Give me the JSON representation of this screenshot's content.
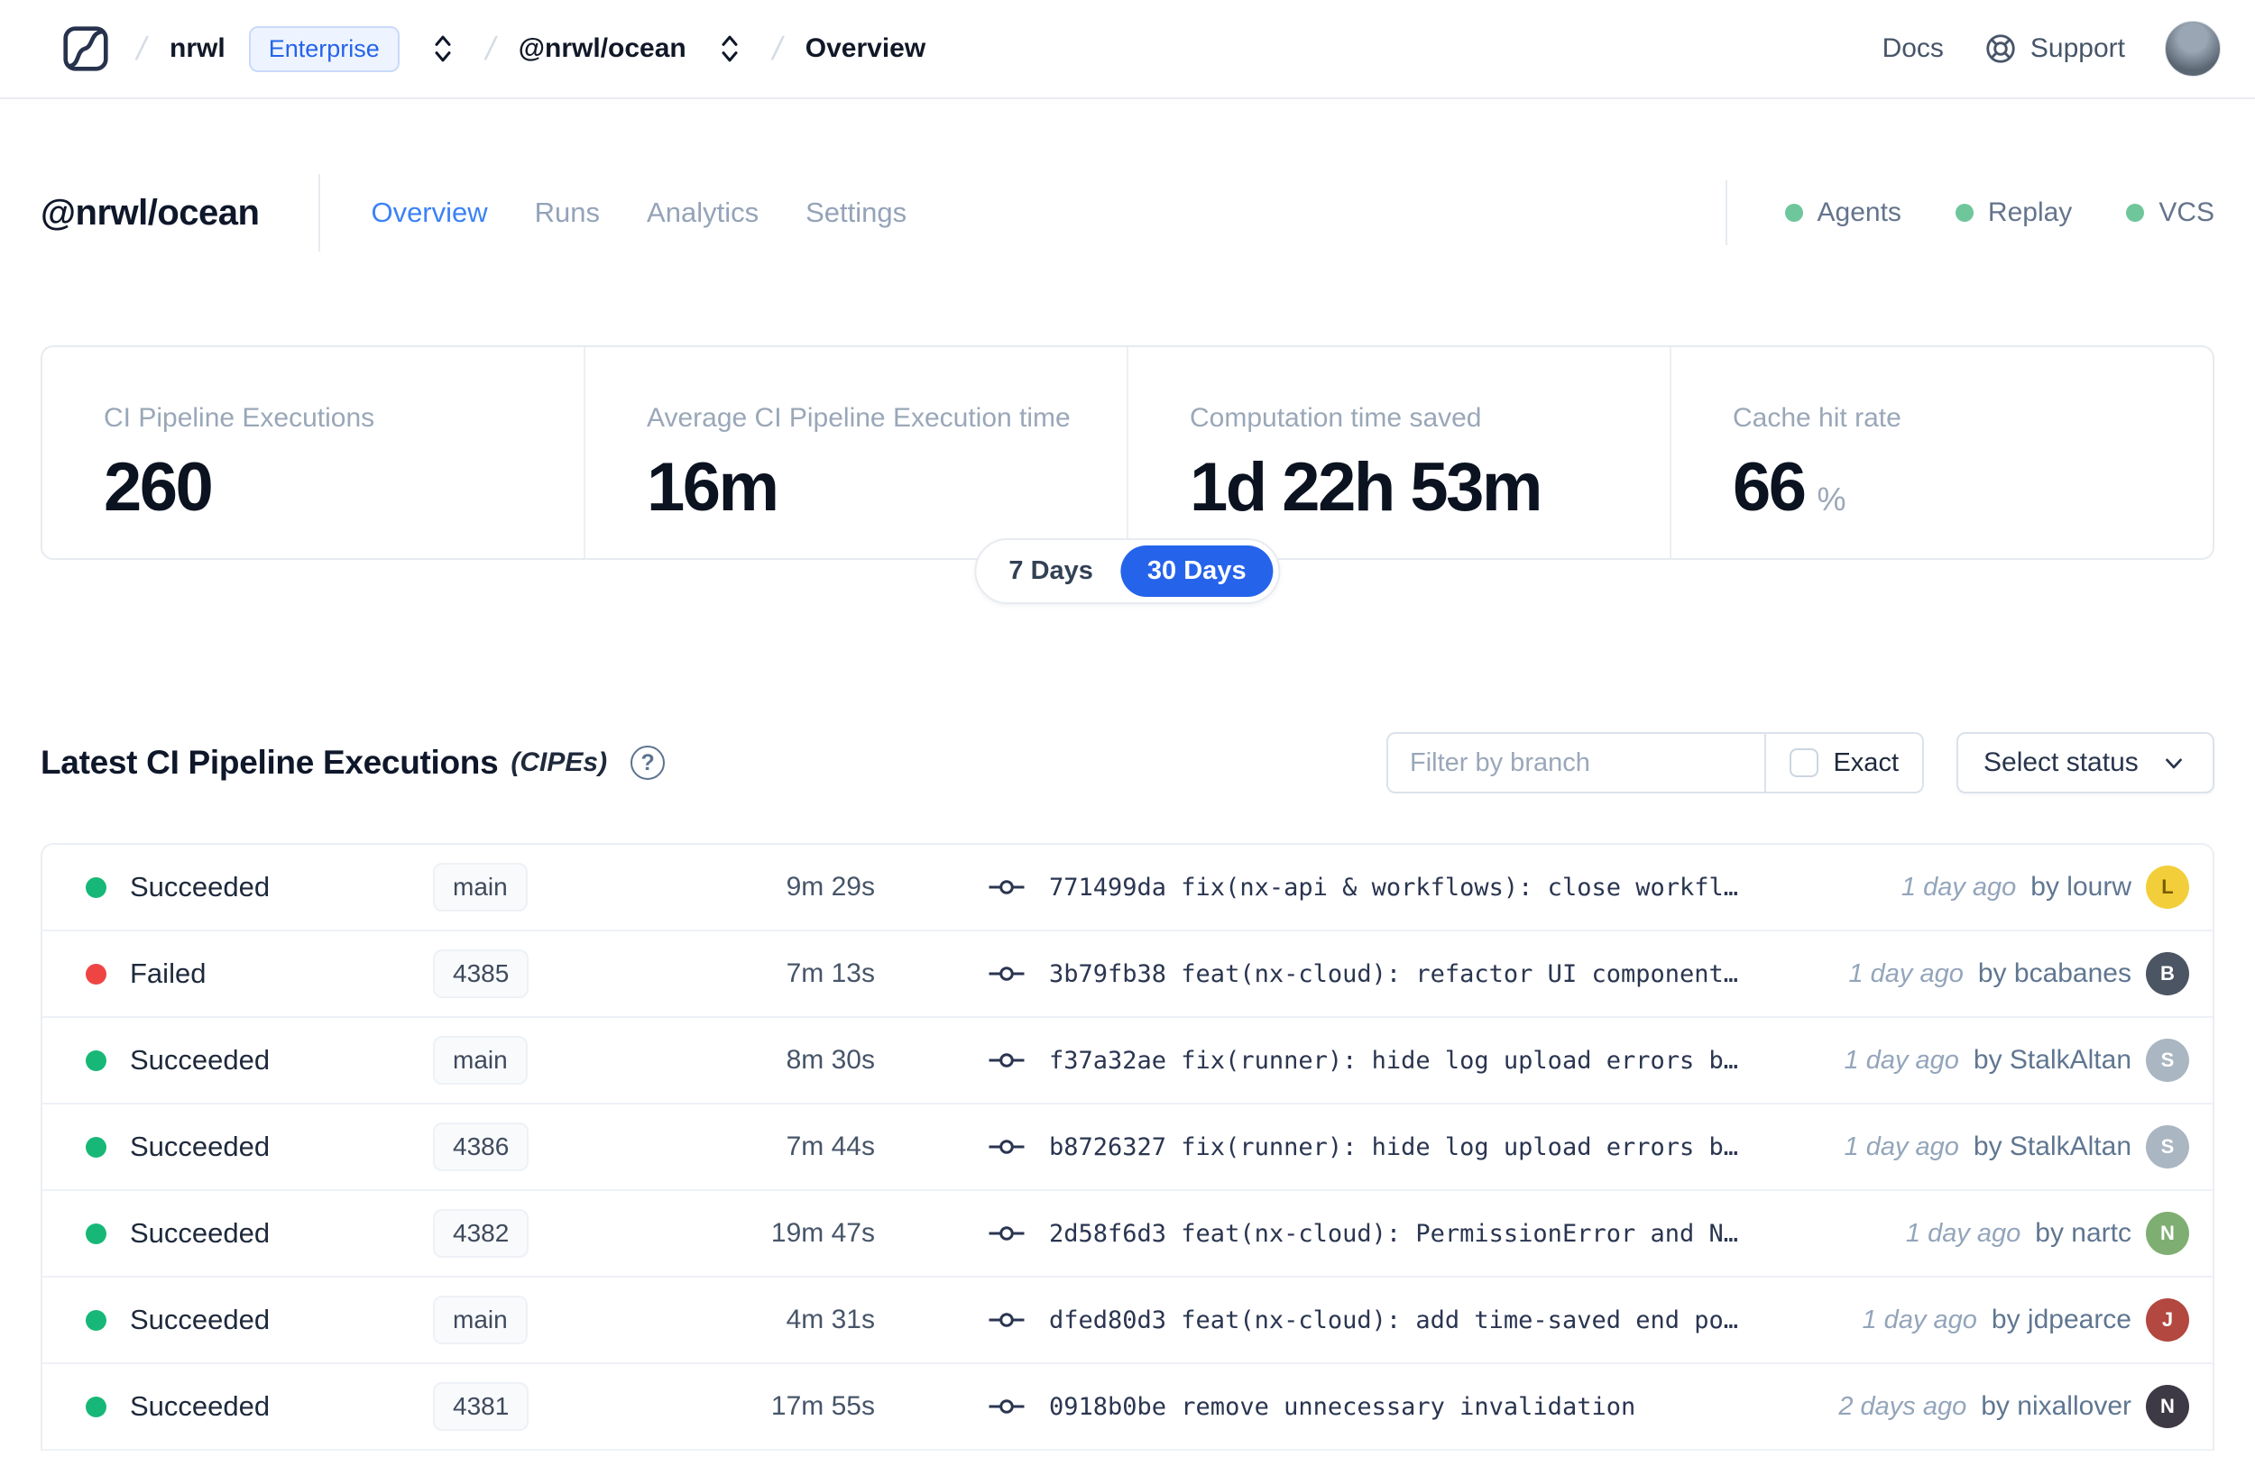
{
  "topbar": {
    "separator": "/",
    "org": "nrwl",
    "org_badge": "Enterprise",
    "workspace": "@nrwl/ocean",
    "page": "Overview",
    "docs_label": "Docs",
    "support_label": "Support"
  },
  "header": {
    "title": "@nrwl/ocean",
    "tabs": [
      {
        "label": "Overview"
      },
      {
        "label": "Runs"
      },
      {
        "label": "Analytics"
      },
      {
        "label": "Settings"
      }
    ],
    "features": [
      {
        "label": "Agents"
      },
      {
        "label": "Replay"
      },
      {
        "label": "VCS"
      }
    ],
    "feature_dot_color": "#6fc69b"
  },
  "stats": {
    "cards": [
      {
        "label": "CI Pipeline Executions",
        "value": "260"
      },
      {
        "label": "Average CI Pipeline Execution time",
        "value": "16m"
      },
      {
        "label": "Computation time saved",
        "value": "1d 22h 53m"
      },
      {
        "label": "Cache hit rate",
        "value": "66",
        "unit": "%"
      }
    ],
    "range_toggle": {
      "options": [
        "7 Days",
        "30 Days"
      ],
      "selected": "30 Days",
      "selected_color": "#2563eb"
    }
  },
  "section": {
    "title": "Latest CI Pipeline Executions",
    "subtitle": "(CIPEs)",
    "help_glyph": "?",
    "filter_placeholder": "Filter by branch",
    "exact_label": "Exact",
    "status_select_label": "Select status"
  },
  "table": {
    "rows": [
      {
        "status": "Succeeded",
        "status_color": "#17b877",
        "branch": "main",
        "duration": "9m 29s",
        "commit": "771499da fix(nx-api & workflows): close workfl…",
        "time": "1 day ago",
        "author": "by lourw",
        "avatar_initial": "L",
        "avatar_color": "#f2cf3a",
        "avatar_text_color": "#7a5d00"
      },
      {
        "status": "Failed",
        "status_color": "#ef4444",
        "branch": "4385",
        "duration": "7m 13s",
        "commit": "3b79fb38 feat(nx-cloud): refactor UI component…",
        "time": "1 day ago",
        "author": "by bcabanes",
        "avatar_initial": "B",
        "avatar_color": "#4b5563",
        "avatar_text_color": "#ffffff"
      },
      {
        "status": "Succeeded",
        "status_color": "#17b877",
        "branch": "main",
        "duration": "8m 30s",
        "commit": "f37a32ae fix(runner): hide log upload errors b…",
        "time": "1 day ago",
        "author": "by StalkAltan",
        "avatar_initial": "S",
        "avatar_color": "#aab6c2",
        "avatar_text_color": "#ffffff"
      },
      {
        "status": "Succeeded",
        "status_color": "#17b877",
        "branch": "4386",
        "duration": "7m 44s",
        "commit": "b8726327 fix(runner): hide log upload errors b…",
        "time": "1 day ago",
        "author": "by StalkAltan",
        "avatar_initial": "S",
        "avatar_color": "#aab6c2",
        "avatar_text_color": "#ffffff"
      },
      {
        "status": "Succeeded",
        "status_color": "#17b877",
        "branch": "4382",
        "duration": "19m 47s",
        "commit": "2d58f6d3 feat(nx-cloud): PermissionError and N…",
        "time": "1 day ago",
        "author": "by nartc",
        "avatar_initial": "N",
        "avatar_color": "#7fae72",
        "avatar_text_color": "#ffffff"
      },
      {
        "status": "Succeeded",
        "status_color": "#17b877",
        "branch": "main",
        "duration": "4m 31s",
        "commit": "dfed80d3 feat(nx-cloud): add time-saved end po…",
        "time": "1 day ago",
        "author": "by jdpearce",
        "avatar_initial": "J",
        "avatar_color": "#b2483f",
        "avatar_text_color": "#ffffff"
      },
      {
        "status": "Succeeded",
        "status_color": "#17b877",
        "branch": "4381",
        "duration": "17m 55s",
        "commit": "0918b0be remove unnecessary invalidation",
        "time": "2 days ago",
        "author": "by nixallover",
        "avatar_initial": "N",
        "avatar_color": "#3e3a45",
        "avatar_text_color": "#ffffff"
      }
    ]
  }
}
